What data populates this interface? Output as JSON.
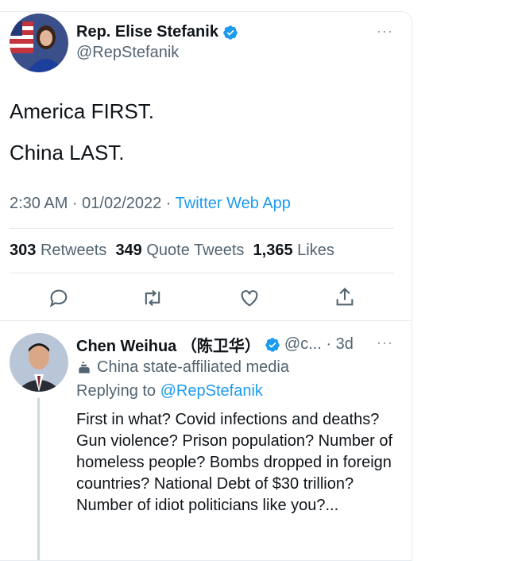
{
  "tweet": {
    "author_name": "Rep. Elise Stefanik",
    "author_handle": "@RepStefanik",
    "more": "···",
    "line1": "America FIRST.",
    "line2": "China LAST.",
    "time": "2:30 AM · 01/02/2022 · ",
    "app": "Twitter Web App",
    "retweets_count": "303",
    "retweets_label": "Retweets",
    "quotes_count": "349",
    "quotes_label": "Quote Tweets",
    "likes_count": "1,365",
    "likes_label": "Likes"
  },
  "reply": {
    "author_name": "Chen Weihua （陈卫华）",
    "handle_time": "@c... · 3d",
    "more": "···",
    "label": "China state-affiliated media",
    "replying_prefix": "Replying to ",
    "replying_mention": "@RepStefanik",
    "text": "First in what? Covid infections and deaths? Gun violence? Prison population? Number of homeless people? Bombs dropped in foreign countries? National Debt of $30 trillion? Number of idiot politicians like you?..."
  },
  "colors": {
    "link": "#1d9bf0",
    "muted": "#536471",
    "verified": "#1d9bf0"
  },
  "icons": [
    "verified-badge-icon",
    "reply-icon",
    "retweet-icon",
    "like-icon",
    "share-icon",
    "state-media-icon"
  ]
}
